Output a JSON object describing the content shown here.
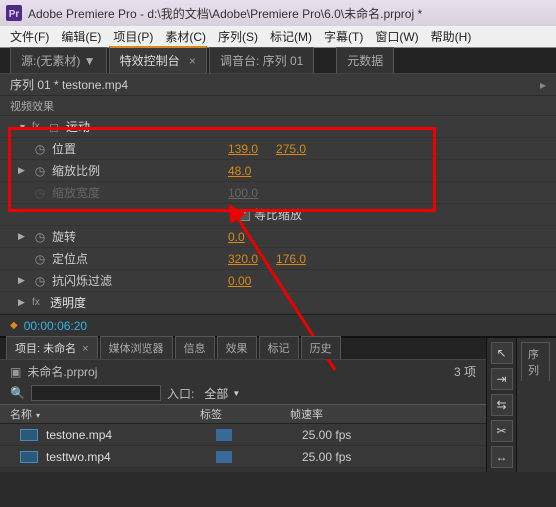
{
  "titlebar": {
    "text": "Adobe Premiere Pro - d:\\我的文档\\Adobe\\Premiere Pro\\6.0\\未命名.prproj *"
  },
  "menu": [
    "文件(F)",
    "编辑(E)",
    "项目(P)",
    "素材(C)",
    "序列(S)",
    "标记(M)",
    "字幕(T)",
    "窗口(W)",
    "帮助(H)"
  ],
  "topTabs": {
    "source": "源:(无素材)",
    "effects": "特效控制台",
    "mixer": "调音台: 序列 01",
    "metadata": "元数据"
  },
  "panelHead": {
    "title": "序列 01 * testone.mp4",
    "right": ""
  },
  "sectionHead": "视频效果",
  "motion": {
    "group": "运动",
    "position": {
      "label": "位置",
      "x": "139.0",
      "y": "275.0"
    },
    "scale": {
      "label": "缩放比例",
      "v": "48.0"
    },
    "scaleW": {
      "label": "缩放宽度",
      "v": "100.0"
    },
    "uniform": {
      "label": "等比缩放"
    },
    "rotation": {
      "label": "旋转",
      "v": "0.0"
    },
    "anchor": {
      "label": "定位点",
      "x": "320.0",
      "y": "176.0"
    },
    "flicker": {
      "label": "抗闪烁过滤",
      "v": "0.00"
    }
  },
  "opacity": {
    "group": "透明度"
  },
  "timecode": "00:00:06:20",
  "projectTabs": [
    "项目: 未命名",
    "媒体浏览器",
    "信息",
    "效果",
    "标记",
    "历史"
  ],
  "project": {
    "name": "未命名.prproj",
    "count": "3 项",
    "inlabel": "入口:",
    "inval": "全部",
    "cols": {
      "name": "名称",
      "tag": "标签",
      "fps": "帧速率"
    },
    "items": [
      {
        "name": "testone.mp4",
        "fps": "25.00 fps"
      },
      {
        "name": "testtwo.mp4",
        "fps": "25.00 fps"
      }
    ]
  },
  "rightTab": "序列"
}
